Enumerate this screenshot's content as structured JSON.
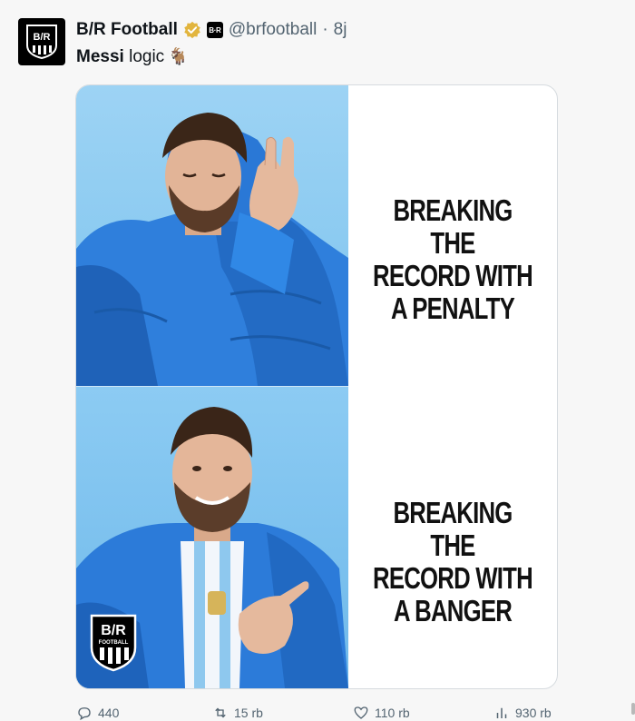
{
  "author": {
    "name": "B/R Football",
    "handle": "@brfootball",
    "separator": "·",
    "time": "8j",
    "avatar_text": "B/R",
    "mini_logo_text": "B·R"
  },
  "tweet": {
    "bold_part": "Messi",
    "rest": " logic",
    "emoji": "🐐"
  },
  "meme": {
    "top_lines": [
      "BREAKING THE",
      "RECORD WITH",
      "A PENALTY"
    ],
    "bottom_lines": [
      "BREAKING THE",
      "RECORD WITH",
      "A BANGER"
    ],
    "watermark_text": "B/R",
    "watermark_sub": "FOOTBALL"
  },
  "actions": {
    "replies": "440",
    "retweets": "15 rb",
    "likes": "110 rb",
    "views": "930 rb"
  },
  "colors": {
    "sky_blue": "#8ccbf3",
    "jacket_blue": "#1f6fd1",
    "verified_gold": "#e2b53e"
  }
}
